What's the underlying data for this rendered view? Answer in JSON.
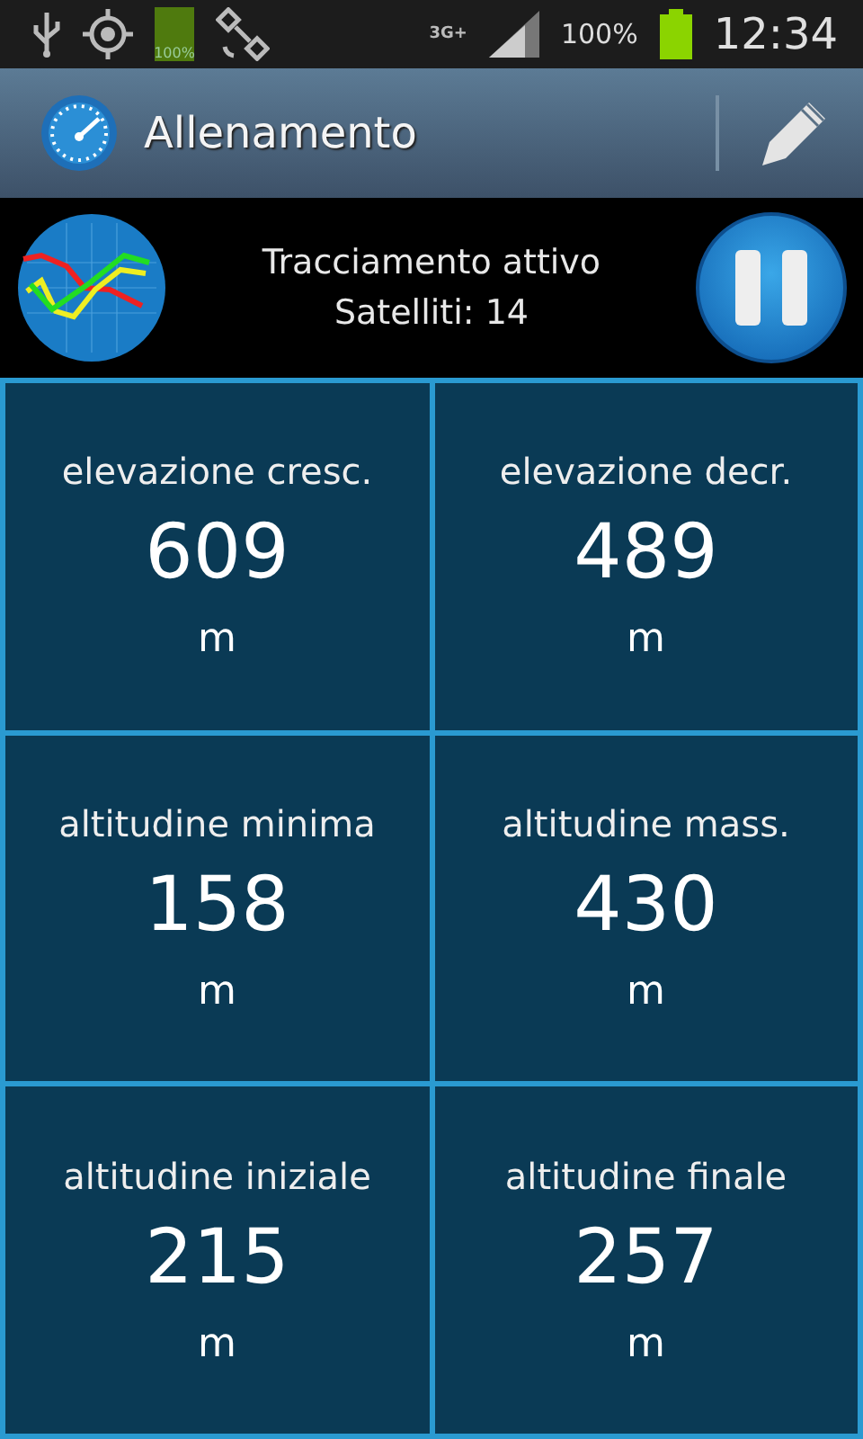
{
  "status_bar": {
    "battery_icon_label": "100%",
    "network": "3G+",
    "battery": "100%",
    "time": "12:34"
  },
  "action_bar": {
    "title": "Allenamento"
  },
  "tracking": {
    "status": "Tracciamento attivo",
    "satellites": "Satelliti: 14"
  },
  "stats": [
    {
      "label": "elevazione cresc.",
      "value": "609",
      "unit": "m"
    },
    {
      "label": "elevazione decr.",
      "value": "489",
      "unit": "m"
    },
    {
      "label": "altitudine minima",
      "value": "158",
      "unit": "m"
    },
    {
      "label": "altitudine mass.",
      "value": "430",
      "unit": "m"
    },
    {
      "label": "altitudine iniziale",
      "value": "215",
      "unit": "m"
    },
    {
      "label": "altitudine finale",
      "value": "257",
      "unit": "m"
    }
  ]
}
